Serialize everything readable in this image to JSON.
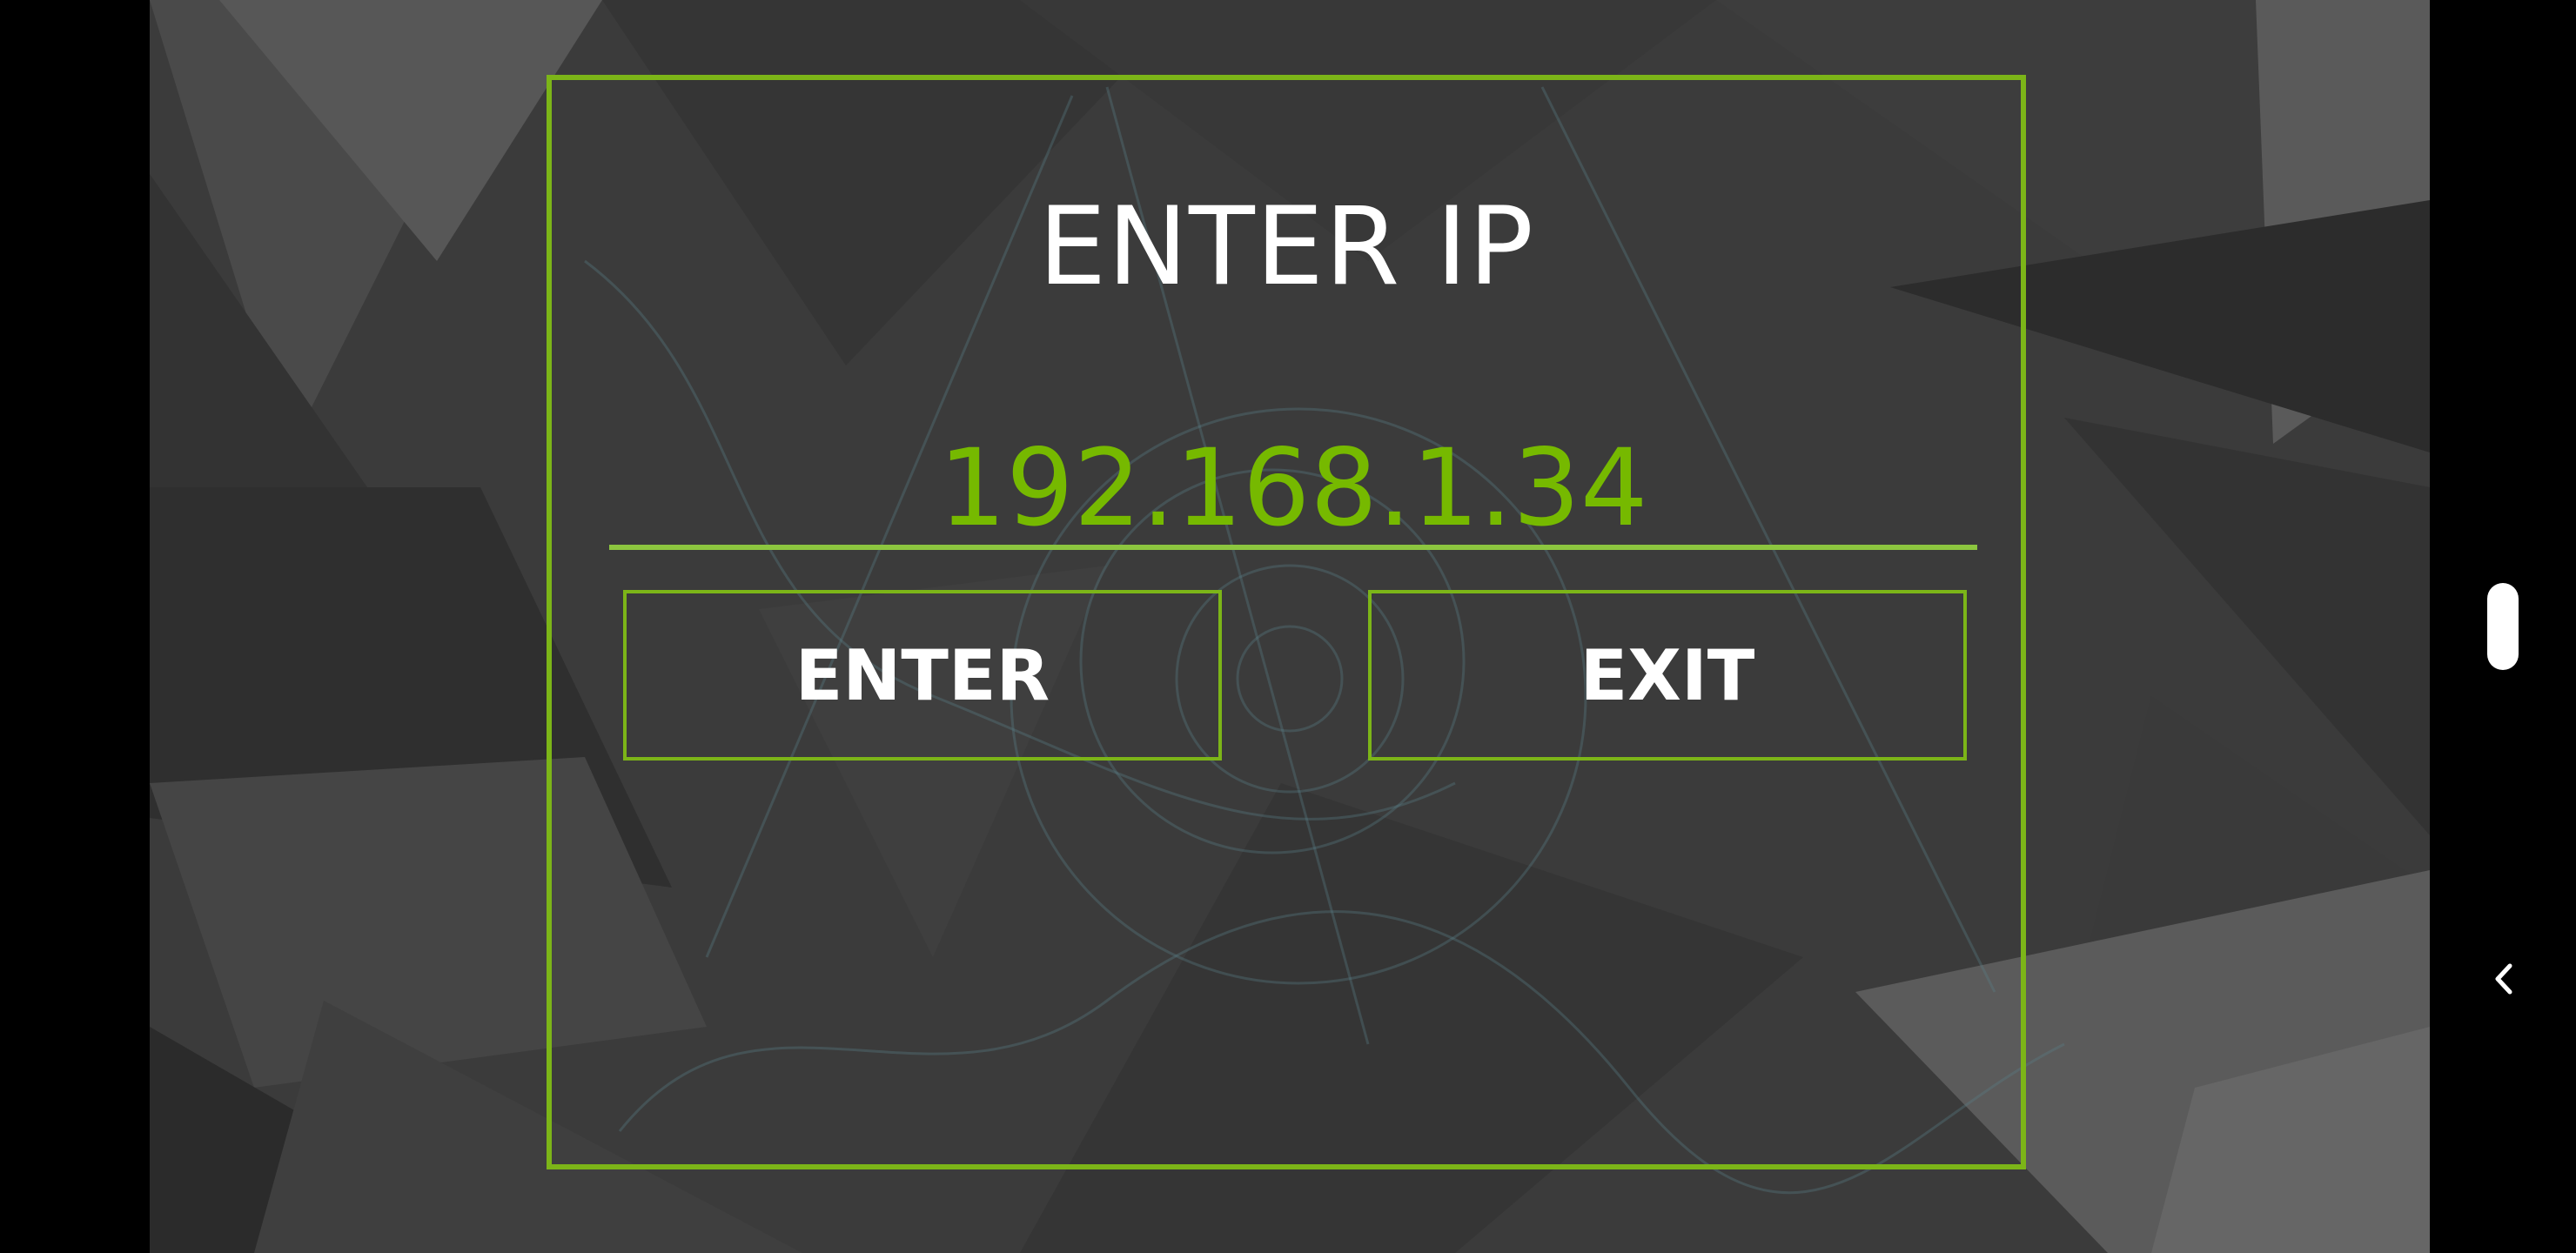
{
  "dialog": {
    "title": "ENTER IP",
    "ip_value": "192.168.1.34",
    "enter_label": "ENTER",
    "exit_label": "EXIT"
  },
  "nav": {
    "handle_icon": "nav-handle-icon",
    "back_icon": "chevron-left-icon"
  },
  "colors": {
    "accent": "#7cb518",
    "ip_text": "#76b900",
    "background": "#3a3a3a",
    "text": "#ffffff"
  }
}
